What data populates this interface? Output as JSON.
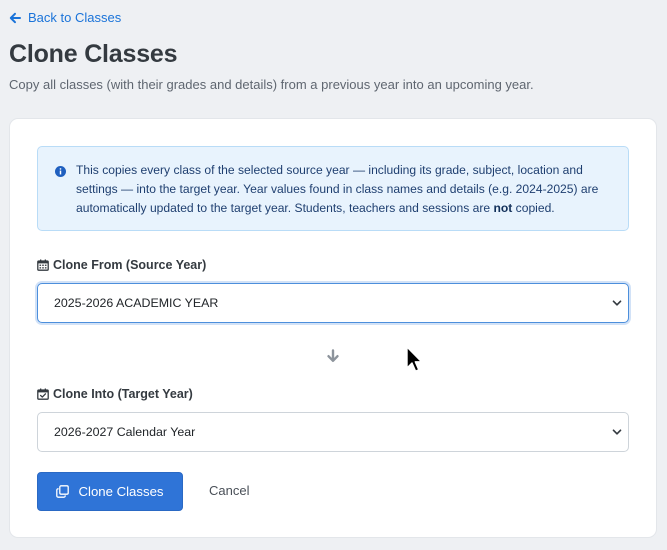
{
  "nav": {
    "back_label": "Back to Classes",
    "back_icon": "arrow-left-icon"
  },
  "header": {
    "title": "Clone Classes",
    "subtitle": "Copy all classes (with their grades and details) from a previous year into an upcoming year."
  },
  "info": {
    "icon": "info-circle-icon",
    "text_before": "This copies every class of the selected source year — including its grade, subject, location and settings — into the target year. Year values found in class names and details (e.g. 2024-2025) are automatically updated to the target year. Students, teachers and sessions are ",
    "emphasis": "not",
    "text_after": " copied."
  },
  "source": {
    "label": "Clone From (Source Year)",
    "icon": "calendar-icon",
    "selected": "2025-2026 ACADEMIC YEAR"
  },
  "target": {
    "label": "Clone Into (Target Year)",
    "icon": "calendar-check-icon",
    "selected": "2026-2027 Calendar Year"
  },
  "actions": {
    "clone_label": "Clone Classes",
    "clone_icon": "copy-icon",
    "cancel_label": "Cancel"
  },
  "colors": {
    "accent": "#2f74d7",
    "link": "#1a73d9",
    "info_bg": "#e8f3fd",
    "info_border": "#b9dcf7"
  }
}
